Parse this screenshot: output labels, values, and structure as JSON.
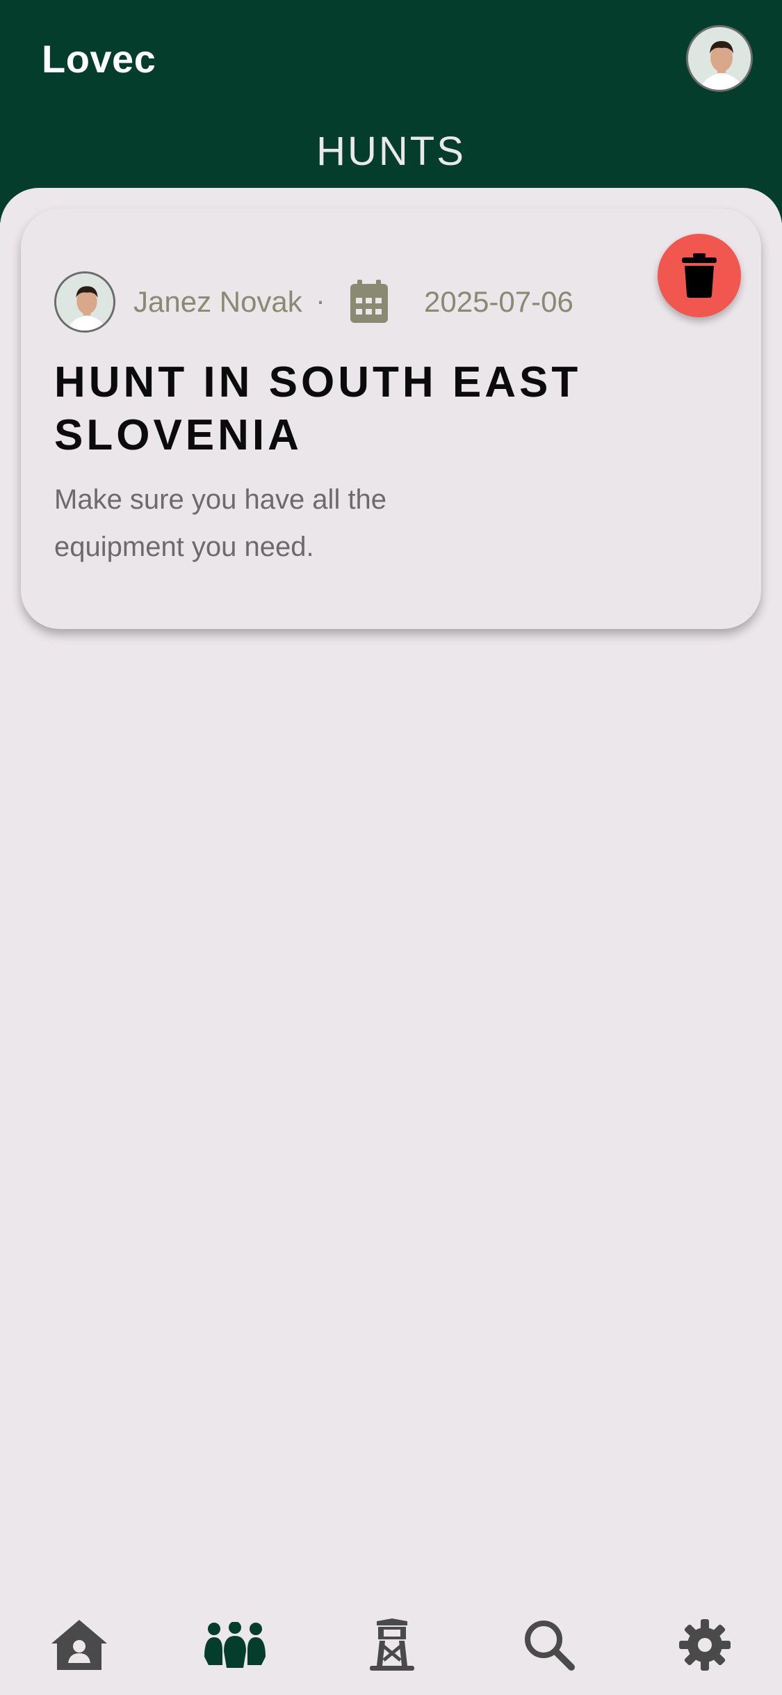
{
  "app": {
    "title": "Lovec"
  },
  "header": {
    "page_title": "HUNTS"
  },
  "hunts": [
    {
      "author": "Janez Novak",
      "separator": "·",
      "date": "2025-07-06",
      "title": "HUNT IN SOUTH EAST SLOVENIA",
      "description": "Make sure you have all the equipment you need."
    }
  ],
  "colors": {
    "header_bg": "#053D2D",
    "accent_active": "#053D2D",
    "delete": "#F1574F",
    "meta_text": "#8A8A72",
    "icon_inactive": "#4A4A4A"
  },
  "bottom_nav": {
    "items": [
      {
        "icon": "home-icon",
        "active": false
      },
      {
        "icon": "group-icon",
        "active": true
      },
      {
        "icon": "hunting-tower-icon",
        "active": false
      },
      {
        "icon": "search-icon",
        "active": false
      },
      {
        "icon": "gear-icon",
        "active": false
      }
    ]
  }
}
